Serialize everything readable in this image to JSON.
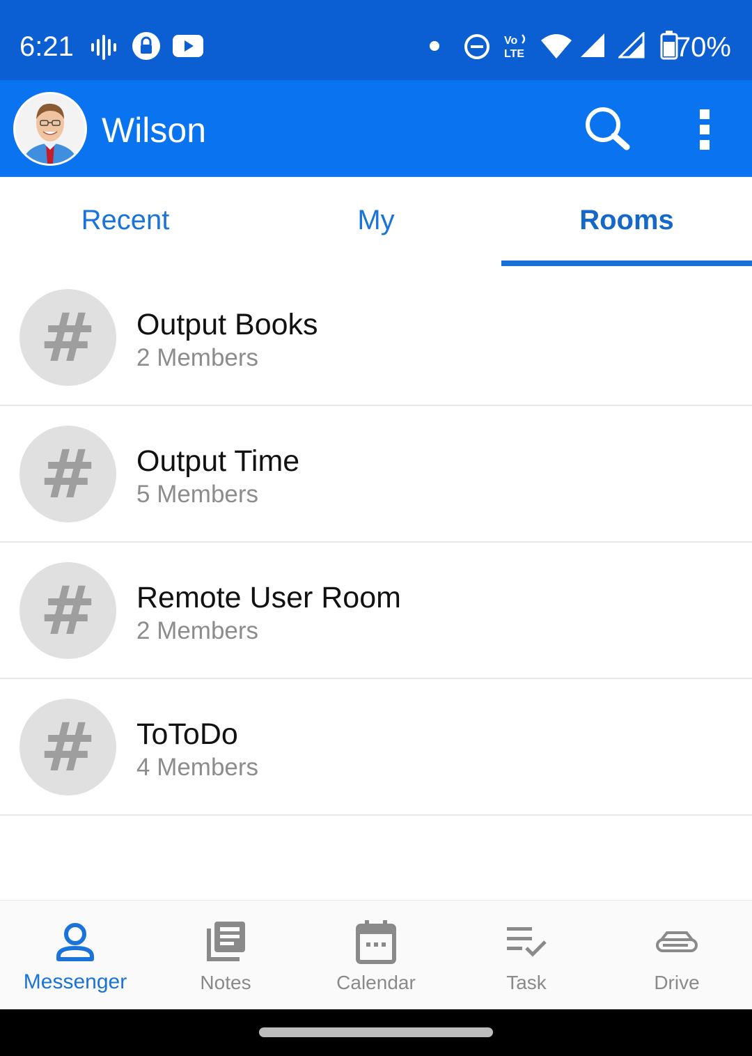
{
  "status_bar": {
    "time": "6:21",
    "battery": "70%",
    "icons": [
      "sound-wave-icon",
      "vpn-lock-icon",
      "youtube-icon",
      "dot-icon",
      "do-not-disturb-icon",
      "volte-icon",
      "wifi-icon",
      "signal-icon",
      "signal-icon-2",
      "battery-icon"
    ]
  },
  "app_bar": {
    "title": "Wilson",
    "background": "#0a74f0",
    "actions": [
      "search-icon",
      "more-vert-icon"
    ]
  },
  "tabs": [
    {
      "label": "Recent",
      "active": false
    },
    {
      "label": "My",
      "active": false
    },
    {
      "label": "Rooms",
      "active": true
    }
  ],
  "rooms": [
    {
      "name": "Output Books",
      "members": "2 Members",
      "icon": "#"
    },
    {
      "name": "Output Time",
      "members": "5 Members",
      "icon": "#"
    },
    {
      "name": "Remote User Room",
      "members": "2 Members",
      "icon": "#"
    },
    {
      "name": "ToToDo",
      "members": "4 Members",
      "icon": "#"
    }
  ],
  "bottom_nav": [
    {
      "label": "Messenger",
      "icon": "person-icon",
      "active": true
    },
    {
      "label": "Notes",
      "icon": "notes-icon",
      "active": false
    },
    {
      "label": "Calendar",
      "icon": "calendar-icon",
      "active": false
    },
    {
      "label": "Task",
      "icon": "task-icon",
      "active": false
    },
    {
      "label": "Drive",
      "icon": "drive-icon",
      "active": false
    }
  ],
  "colors": {
    "status_bar": "#0b5fd2",
    "accent": "#1a73d9",
    "inactive": "#8a8a8a"
  }
}
